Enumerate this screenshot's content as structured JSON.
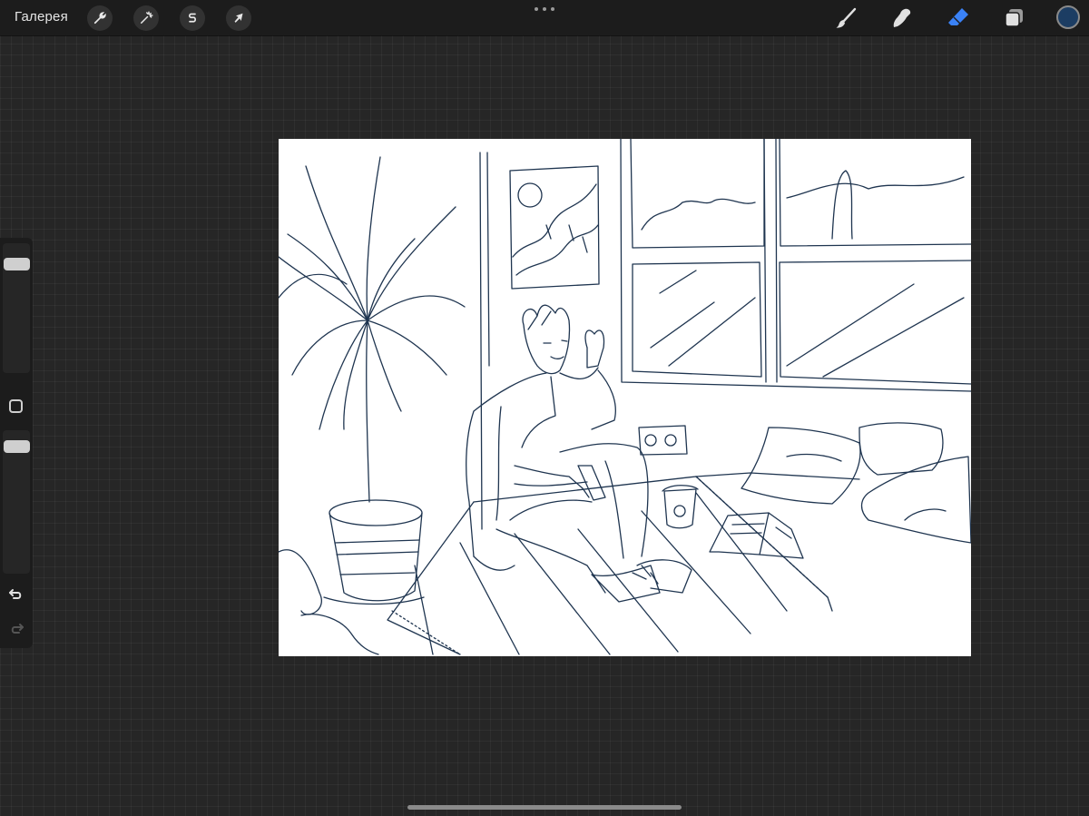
{
  "topbar": {
    "gallery_label": "Галерея",
    "left_tools": [
      {
        "name": "actions",
        "icon": "wrench-icon"
      },
      {
        "name": "adjustments",
        "icon": "magic-wand-icon"
      },
      {
        "name": "selection",
        "icon": "selection-s-icon"
      },
      {
        "name": "transform",
        "icon": "arrow-cursor-icon"
      }
    ],
    "more_icon": "more-dots-icon",
    "right_tools": [
      {
        "name": "brush",
        "icon": "brush-icon",
        "active": false
      },
      {
        "name": "smudge",
        "icon": "smudge-icon",
        "active": false
      },
      {
        "name": "eraser",
        "icon": "eraser-icon",
        "active": true
      },
      {
        "name": "layers",
        "icon": "layers-icon",
        "active": false
      }
    ],
    "current_color": "#1c3d63",
    "active_tool_color": "#3a82f7"
  },
  "sidebar": {
    "brush_size_slider": "brush-size",
    "opacity_slider": "opacity",
    "modify_button": "square-icon",
    "undo_icon": "undo-icon",
    "redo_icon": "redo-icon"
  },
  "canvas": {
    "stroke_color": "#1f3550",
    "background": "#ffffff"
  },
  "colors": {
    "app_background": "#262626",
    "toolbar": "#1c1c1c"
  }
}
